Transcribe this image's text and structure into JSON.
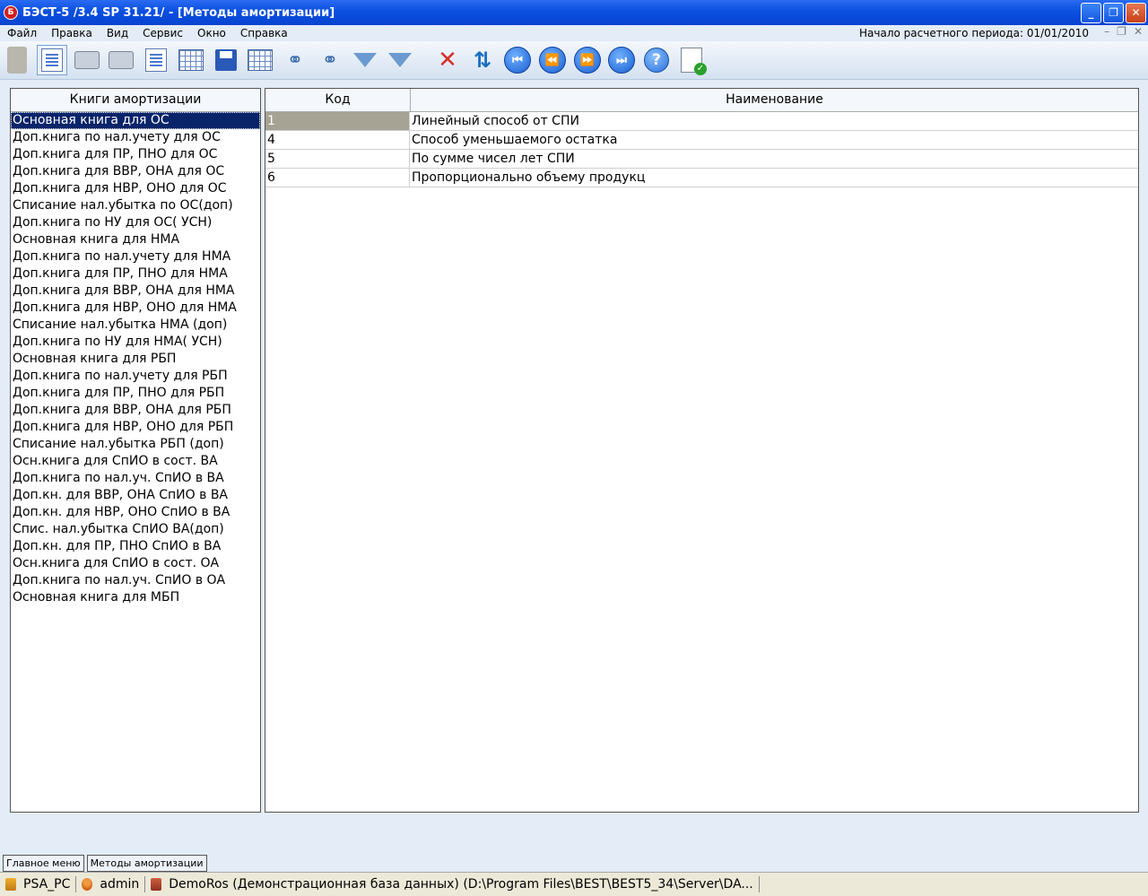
{
  "window": {
    "app_icon_letter": "Б",
    "title": "БЭСТ-5 /3.4 SP 31.21/ - [Методы амортизации]",
    "controls": {
      "minimize": "_",
      "maximize": "❐",
      "close": "✕"
    }
  },
  "menubar": {
    "items": [
      "Файл",
      "Правка",
      "Вид",
      "Сервис",
      "Окно",
      "Справка"
    ],
    "period_label": "Начало расчетного периода: 01/01/2010",
    "mdi_controls": [
      "–",
      "❐",
      "✕"
    ]
  },
  "toolbar": {
    "buttons": [
      {
        "icon": "panel-icon"
      },
      {
        "icon": "report-icon"
      },
      {
        "icon": "print-icon"
      },
      {
        "icon": "print-preview-icon"
      },
      {
        "icon": "edit-icon"
      },
      {
        "icon": "add-record-icon"
      },
      {
        "icon": "save-icon"
      },
      {
        "icon": "delete-record-icon"
      },
      {
        "icon": "find-icon"
      },
      {
        "icon": "find-next-icon"
      },
      {
        "icon": "filter-icon"
      },
      {
        "icon": "filter-dropdown-icon"
      },
      {
        "icon": "clear-filter-icon"
      },
      {
        "icon": "sort-icon"
      },
      {
        "icon": "first-record-icon",
        "glyph": "⏮"
      },
      {
        "icon": "previous-record-icon",
        "glyph": "⏪"
      },
      {
        "icon": "next-record-icon",
        "glyph": "⏩"
      },
      {
        "icon": "last-record-icon",
        "glyph": "⏭"
      },
      {
        "icon": "help-icon",
        "glyph": "?"
      },
      {
        "icon": "confirm-icon"
      }
    ]
  },
  "left_panel": {
    "header": "Книги амортизации",
    "selected_index": 0,
    "items": [
      "Основная книга для ОС",
      "Доп.книга по нал.учету для ОС",
      "Доп.книга для ПР, ПНО для ОС",
      "Доп.книга для ВВР, ОНА для ОС",
      "Доп.книга для НВР, ОНО для ОС",
      "Списание нал.убытка по ОС(доп)",
      "Доп.книга по НУ для ОС( УСН)",
      "Основная книга для НМА",
      "Доп.книга по нал.учету для НМА",
      "Доп.книга для ПР, ПНО для НМА",
      "Доп.книга для ВВР, ОНА для НМА",
      "Доп.книга для НВР, ОНО для НМА",
      "Списание нал.убытка  НМА (доп)",
      "Доп.книга по НУ для НМА( УСН)",
      "Основная книга для РБП",
      "Доп.книга по нал.учету для РБП",
      "Доп.книга для ПР, ПНО для РБП",
      "Доп.книга для ВВР, ОНА для РБП",
      "Доп.книга для НВР, ОНО для РБП",
      "Списание нал.убытка  РБП (доп)",
      "Осн.книга для СпИО в сост. ВА",
      "Доп.книга по нал.уч. СпИО в ВА",
      "Доп.кн. для ВВР, ОНА СпИО в ВА",
      "Доп.кн. для НВР, ОНО СпИО в ВА",
      "Спис. нал.убытка СпИО  ВА(доп)",
      "Доп.кн. для ПР, ПНО СпИО в ВА",
      "Осн.книга для СпИО в сост. ОА",
      "Доп.книга по нал.уч. СпИО в ОА",
      "Основная книга для МБП"
    ]
  },
  "table": {
    "columns": [
      "Код",
      "Наименование"
    ],
    "rows": [
      {
        "code": "1",
        "name": "Линейный способ от СПИ"
      },
      {
        "code": "4",
        "name": "Способ уменьшаемого остатка"
      },
      {
        "code": "5",
        "name": "По сумме чисел лет СПИ"
      },
      {
        "code": "6",
        "name": "Пропорционально объему продукц"
      }
    ]
  },
  "tabs": [
    "Главное меню",
    "Методы амортизации"
  ],
  "statusbar": {
    "computer": "PSA_PC",
    "user": "admin",
    "database": "DemoRos (Демонстрационная база данных) (D:\\Program Files\\BEST\\BEST5_34\\Server\\DA..."
  }
}
